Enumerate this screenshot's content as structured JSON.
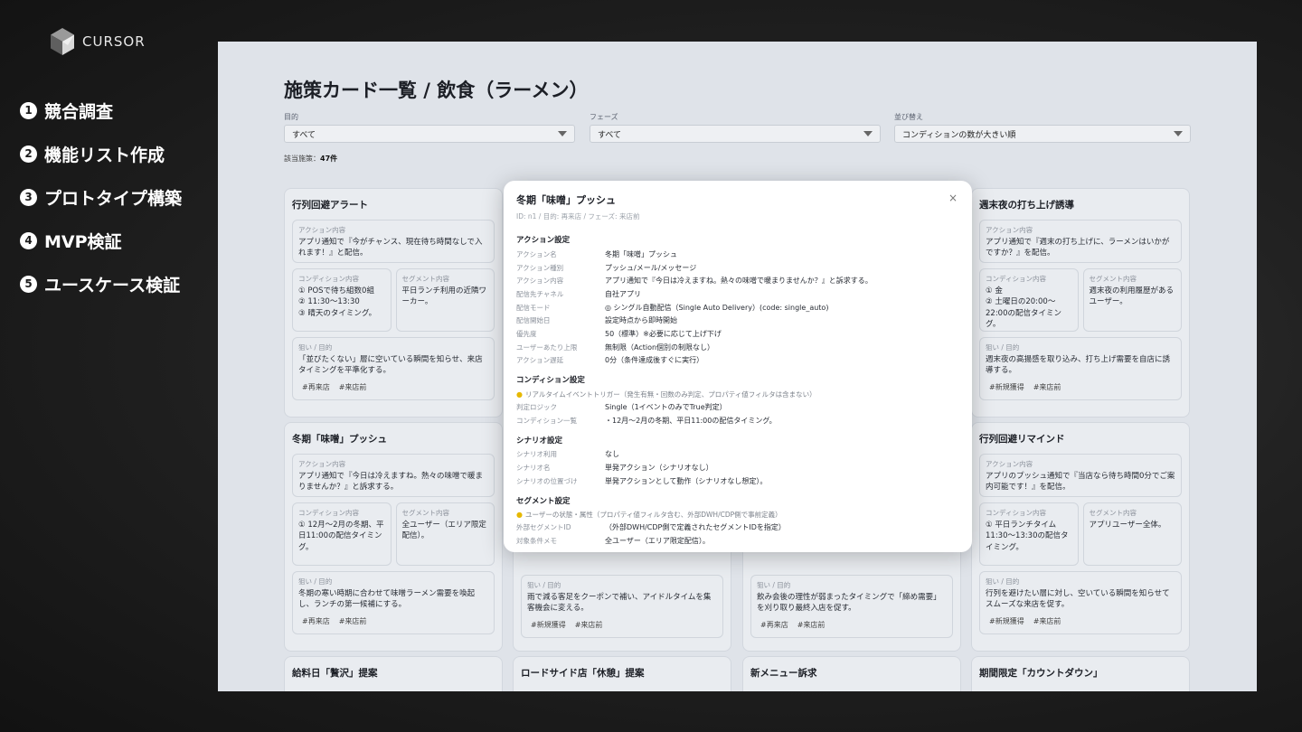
{
  "slide": {
    "logo_text": "CURSOR",
    "steps": [
      {
        "num": "1",
        "label": "競合調査"
      },
      {
        "num": "2",
        "label": "機能リスト作成"
      },
      {
        "num": "3",
        "label": "プロトタイプ構築"
      },
      {
        "num": "4",
        "label": "MVP検証"
      },
      {
        "num": "5",
        "label": "ユースケース検証"
      }
    ]
  },
  "page": {
    "title": "施策カード一覧 / 飲食（ラーメン）",
    "filters": [
      {
        "label": "目的",
        "value": "すべて"
      },
      {
        "label": "フェーズ",
        "value": "すべて"
      },
      {
        "label": "並び替え",
        "value": "コンディションの数が大きい順"
      }
    ],
    "count_label": "該当施策：",
    "count_value": "47件"
  },
  "cards": [
    {
      "title": "行列回避アラート",
      "action_label": "アクション内容",
      "action": "アプリ通知で『今がチャンス、現在待ち時間なしで入れます！』と配信。",
      "condition_label": "コンディション内容",
      "condition": "① POSで待ち組数0組\n② 11:30〜13:30\n③ 晴天のタイミング。",
      "segment_label": "セグメント内容",
      "segment": "平日ランチ利用の近隣ワーカー。",
      "goal_label": "狙い / 目的",
      "goal": "「並びたくない」層に空いている瞬間を知らせ、来店タイミングを平準化する。",
      "tags": [
        "#再来店",
        "#来店前"
      ]
    },
    {
      "title": "週末夜の打ち上げ誘導",
      "action_label": "アクション内容",
      "action": "アプリ通知で『週末の打ち上げに、ラーメンはいかがですか？』を配信。",
      "condition_label": "コンディション内容",
      "condition": "① 金\n② 土曜日の20:00〜22:00の配信タイミング。",
      "segment_label": "セグメント内容",
      "segment": "週末夜の利用履歴があるユーザー。",
      "goal_label": "狙い / 目的",
      "goal": "週末夜の高揚感を取り込み、打ち上げ需要を自店に誘導する。",
      "tags": [
        "#新規獲得",
        "#来店前"
      ]
    },
    {
      "title": "冬期「味噌」プッシュ",
      "action_label": "アクション内容",
      "action": "アプリ通知で『今日は冷えますね。熱々の味噌で暖まりませんか？』と訴求する。",
      "condition_label": "コンディション内容",
      "condition": "① 12月〜2月の冬期、平日11:00の配信タイミング。",
      "segment_label": "セグメント内容",
      "segment": "全ユーザー（エリア限定配信）。",
      "goal_label": "狙い / 目的",
      "goal": "冬期の寒い時期に合わせて味噌ラーメン需要を喚起し、ランチの第一候補にする。",
      "tags": [
        "#再来店",
        "#来店前"
      ]
    },
    {
      "goal_label": "狙い / 目的",
      "goal": "雨で減る客足をクーポンで補い、アイドルタイムを集客機会に変える。",
      "tags": [
        "#新規獲得",
        "#来店前"
      ]
    },
    {
      "goal_label": "狙い / 目的",
      "goal": "飲み会後の理性が弱まったタイミングで「締め需要」を刈り取り最終入店を促す。",
      "tags": [
        "#再来店",
        "#来店前"
      ]
    },
    {
      "title": "行列回避リマインド",
      "action_label": "アクション内容",
      "action": "アプリのプッシュ通知で『当店なら待ち時間0分でご案内可能です！』を配信。",
      "condition_label": "コンディション内容",
      "condition": "① 平日ランチタイム11:30〜13:30の配信タイミング。",
      "segment_label": "セグメント内容",
      "segment": "アプリユーザー全体。",
      "goal_label": "狙い / 目的",
      "goal": "行列を避けたい層に対し、空いている瞬間を知らせてスムーズな来店を促す。",
      "tags": [
        "#新規獲得",
        "#来店前"
      ]
    },
    {
      "title": "給料日「贅沢」提案"
    },
    {
      "title": "ロードサイド店「休憩」提案"
    },
    {
      "title": "新メニュー訴求"
    },
    {
      "title": "期間限定「カウントダウン」"
    }
  ],
  "modal": {
    "title": "冬期「味噌」プッシュ",
    "subtitle": "ID: n1 / 目的: 再来店 / フェーズ: 来店前",
    "close": "×",
    "sections": [
      {
        "title": "アクション設定",
        "rows": [
          {
            "k": "アクション名",
            "v": "冬期「味噌」プッシュ"
          },
          {
            "k": "アクション種別",
            "v": "プッシュ/メール/メッセージ"
          },
          {
            "k": "アクション内容",
            "v": "アプリ通知で『今日は冷えますね。熱々の味噌で暖まりませんか？』と訴求する。"
          },
          {
            "k": "配信先チャネル",
            "v": "自社アプリ"
          },
          {
            "k": "配信モード",
            "v": "◎ シングル自動配信（Single Auto Delivery）(code: single_auto)"
          },
          {
            "k": "配信開始日",
            "v": "設定時点から即時開始"
          },
          {
            "k": "優先度",
            "v": "50（標準）※必要に応じて上げ下げ"
          },
          {
            "k": "ユーザーあたり上限",
            "v": "無制限（Action個別の制限なし）"
          },
          {
            "k": "アクション遅延",
            "v": "0分（条件達成後すぐに実行）"
          }
        ]
      },
      {
        "title": "コンディション設定",
        "hint": "リアルタイムイベントトリガー（発生有無・回数のみ判定、プロパティ値フィルタは含まない）",
        "rows": [
          {
            "k": "判定ロジック",
            "v": "Single（1イベントのみでTrue判定）"
          },
          {
            "k": "コンディション一覧",
            "v": "・12月〜2月の冬期、平日11:00の配信タイミング。"
          }
        ]
      },
      {
        "title": "シナリオ設定",
        "rows": [
          {
            "k": "シナリオ利用",
            "v": "なし"
          },
          {
            "k": "シナリオ名",
            "v": "単発アクション（シナリオなし）"
          },
          {
            "k": "シナリオの位置づけ",
            "v": "単発アクションとして動作（シナリオなし想定）。"
          }
        ]
      },
      {
        "title": "セグメント設定",
        "hint": "ユーザーの状態・属性（プロパティ値フィルタ含む、外部DWH/CDP側で事前定義）",
        "rows": [
          {
            "k": "外部セグメントID",
            "v": "（外部DWH/CDP側で定義されたセグメントIDを指定）"
          },
          {
            "k": "対象条件メモ",
            "v": "全ユーザー（エリア限定配信）。"
          }
        ]
      }
    ]
  },
  "colors": {
    "slide_bg": "#1b1b1b",
    "screen_bg": "#dfe3e9",
    "modal_bg": "#ffffff",
    "bulb": "#e6b800"
  }
}
